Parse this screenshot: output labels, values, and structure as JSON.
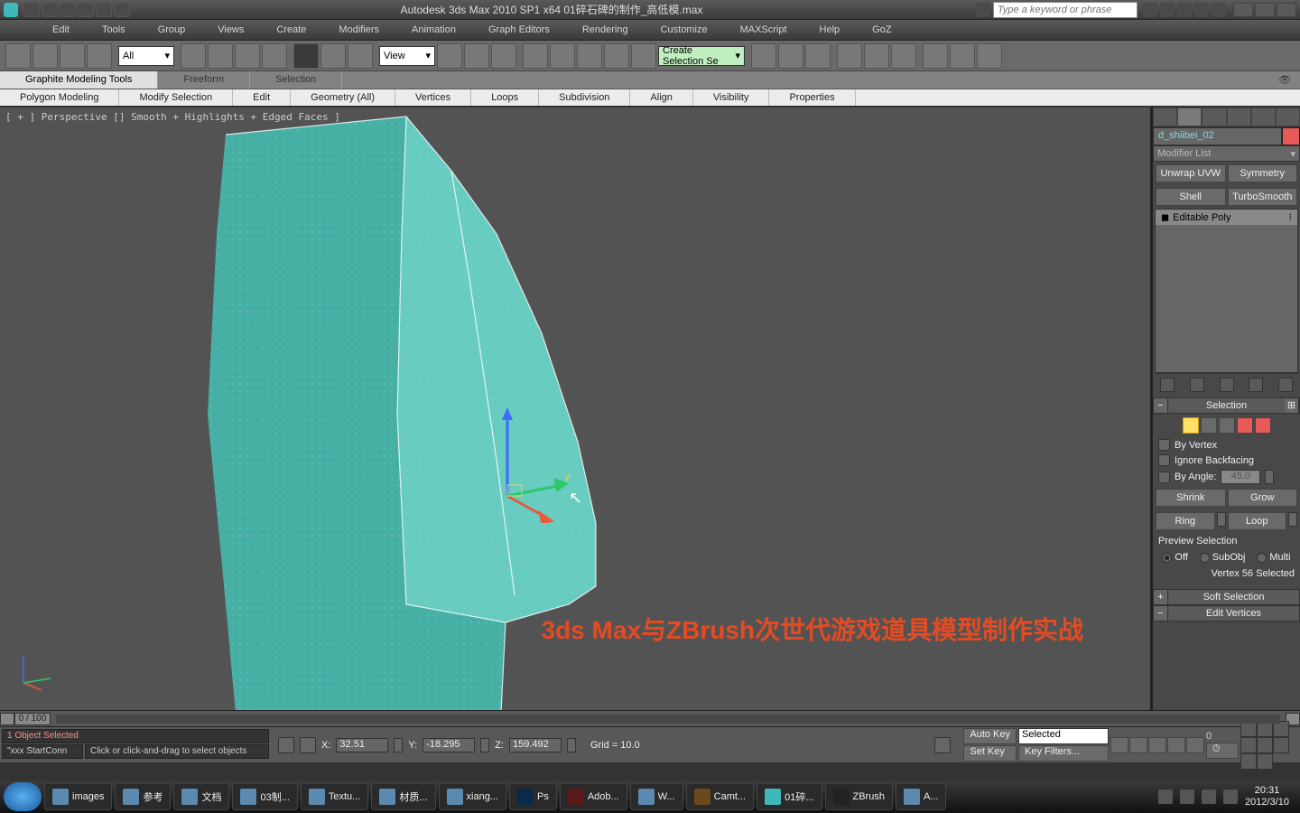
{
  "titlebar": {
    "title": "Autodesk 3ds Max  2010 SP1 x64      01碎石碑的制作_高低模.max",
    "search_placeholder": "Type a keyword or phrase"
  },
  "menu": [
    "Edit",
    "Tools",
    "Group",
    "Views",
    "Create",
    "Modifiers",
    "Animation",
    "Graph Editors",
    "Rendering",
    "Customize",
    "MAXScript",
    "Help",
    "GoZ"
  ],
  "toolbar": {
    "sel_filter": "All",
    "ref_coord": "View",
    "create_sel": "Create Selection Se"
  },
  "ribbon_tabs": [
    "Graphite Modeling Tools",
    "Freeform",
    "Selection"
  ],
  "ribbon_groups": [
    "Polygon Modeling",
    "Modify Selection",
    "Edit",
    "Geometry (All)",
    "Vertices",
    "Loops",
    "Subdivision",
    "Align",
    "Visibility",
    "Properties"
  ],
  "viewport_label": "[ + ] Perspective [] Smooth + Highlights + Edged Faces ]",
  "cmd": {
    "obj_name": "d_shiibei_02",
    "modifier_list": "Modifier List",
    "preset_btns": [
      "Unwrap UVW",
      "Symmetry",
      "Shell",
      "TurboSmooth"
    ],
    "stack_item": "Editable Poly",
    "selection_hd": "Selection",
    "by_vertex": "By Vertex",
    "ignore_backfacing": "Ignore Backfacing",
    "by_angle": "By Angle:",
    "angle_val": "45.0",
    "shrink": "Shrink",
    "grow": "Grow",
    "ring": "Ring",
    "loop": "Loop",
    "preview": "Preview Selection",
    "off": "Off",
    "subobj": "SubObj",
    "multi": "Multi",
    "sel_status": "Vertex 56 Selected",
    "soft_sel": "Soft Selection",
    "edit_verts": "Edit Vertices"
  },
  "timeline": {
    "frame": "0 / 100"
  },
  "prompt": {
    "line1": "1 Object Selected",
    "line2": "\"xxx StartConn",
    "line3": "Click or click-and-drag to select objects"
  },
  "coords": {
    "x": "32.51",
    "y": "-18.295",
    "z": "159.492",
    "grid": "Grid = 10.0"
  },
  "anim": {
    "auto": "Auto Key",
    "set": "Set Key",
    "selected": "Selected",
    "filters": "Key Filters..."
  },
  "taskbar": {
    "items": [
      "images",
      "参考",
      "文档",
      "03制...",
      "Textu...",
      "材质...",
      "xiang...",
      "Ps",
      "Adob...",
      "W...",
      "Camt...",
      "01碎...",
      "ZBrush",
      "A..."
    ],
    "time": "20:31",
    "date": "2012/3/10"
  },
  "overlay": "3ds Max与ZBrush次世代游戏道具模型制作实战"
}
